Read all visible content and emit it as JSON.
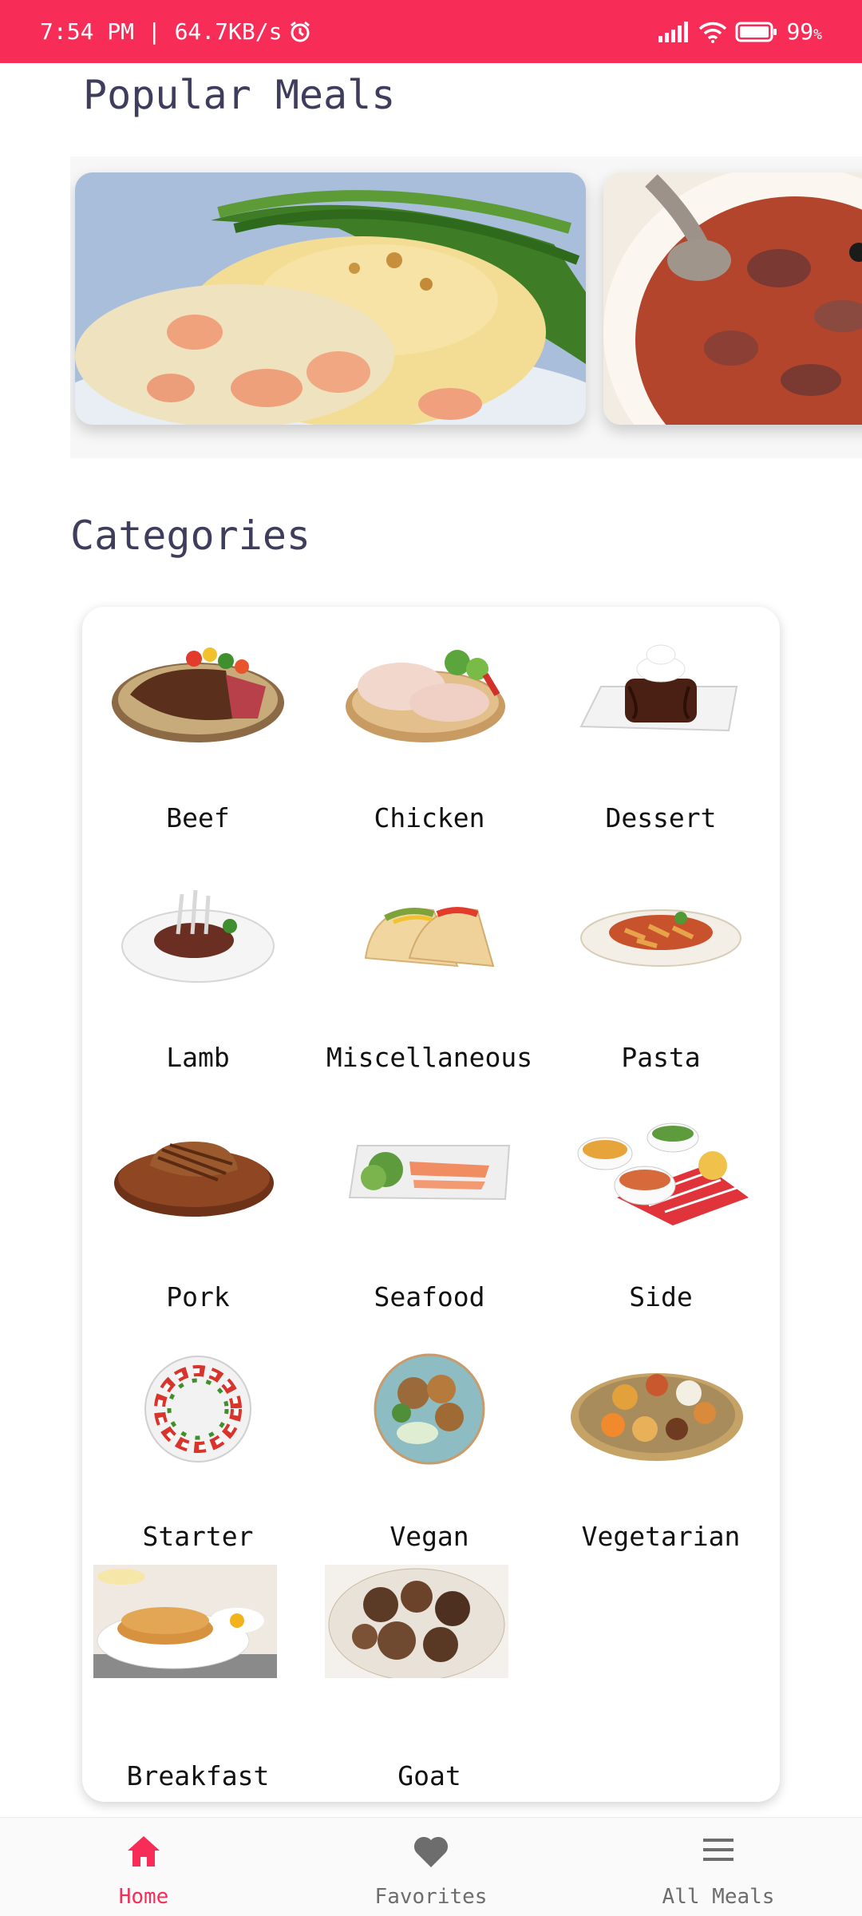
{
  "status_bar": {
    "time_speed": "7:54 PM | 64.7KB/s",
    "battery": "99",
    "icons": [
      "alarm-icon",
      "signal-icon",
      "wifi-icon",
      "battery-icon"
    ]
  },
  "popular": {
    "title": "Popular Meals"
  },
  "categories": {
    "title": "Categories",
    "items": [
      {
        "label": "Beef"
      },
      {
        "label": "Chicken"
      },
      {
        "label": "Dessert"
      },
      {
        "label": "Lamb"
      },
      {
        "label": "Miscellaneous"
      },
      {
        "label": "Pasta"
      },
      {
        "label": "Pork"
      },
      {
        "label": "Seafood"
      },
      {
        "label": "Side"
      },
      {
        "label": "Starter"
      },
      {
        "label": "Vegan"
      },
      {
        "label": "Vegetarian"
      },
      {
        "label": "Breakfast"
      },
      {
        "label": "Goat"
      }
    ]
  },
  "bottom_nav": {
    "items": [
      {
        "label": "Home",
        "icon": "home-icon",
        "active": true
      },
      {
        "label": "Favorites",
        "icon": "heart-icon",
        "active": false
      },
      {
        "label": "All Meals",
        "icon": "menu-icon",
        "active": false
      }
    ]
  },
  "colors": {
    "accent": "#f72d58",
    "title": "#3f3d5c",
    "nav_inactive": "#6d6d6d"
  }
}
